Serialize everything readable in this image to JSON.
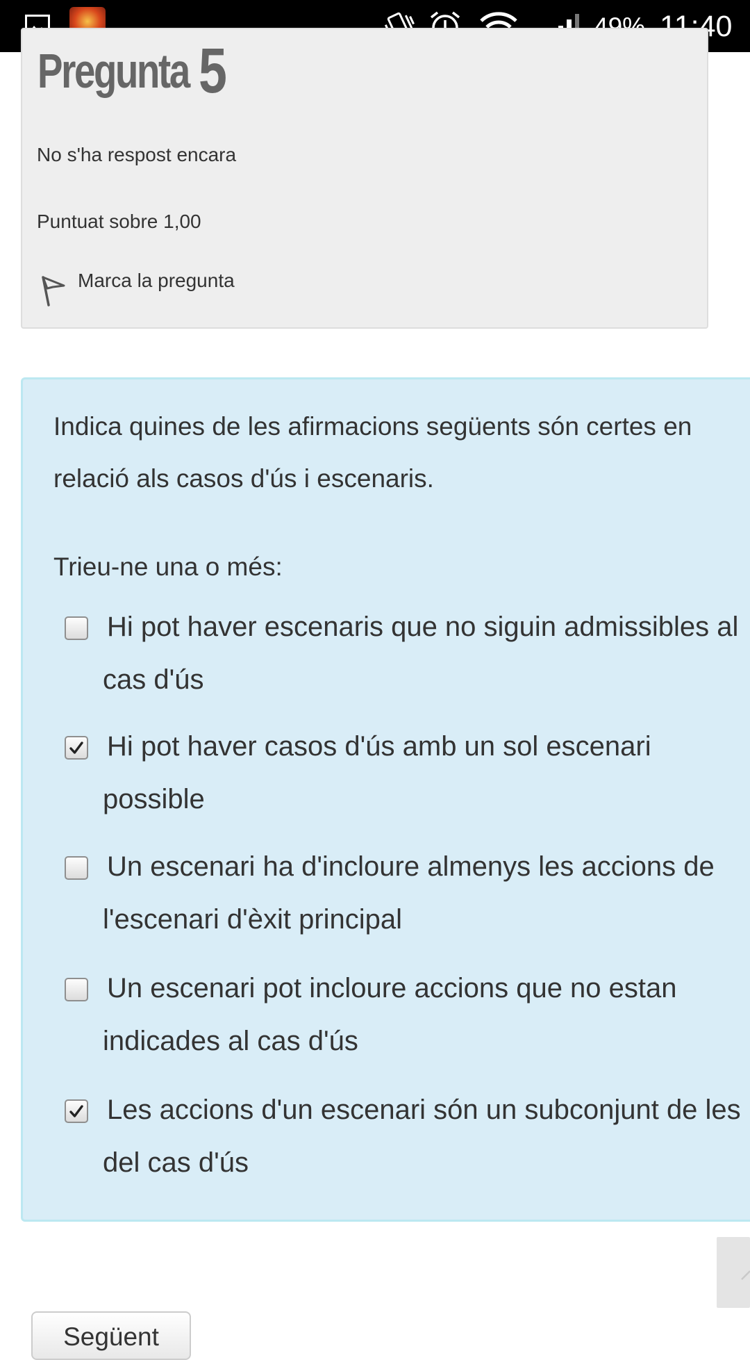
{
  "status_bar": {
    "icons": [
      "gallery-icon",
      "game-app-icon",
      "vibrate-icon",
      "alarm-icon",
      "wifi-icon",
      "signal-icon"
    ],
    "battery": "49%",
    "time": "11:40"
  },
  "question_info": {
    "label": "Pregunta",
    "number": "5",
    "state": "No s'ha respost encara",
    "grade": "Puntuat sobre 1,00",
    "flag_label": "Marca la pregunta"
  },
  "question": {
    "text": "Indica quines de les afirmacions següents són certes en relació als casos d'ús i escenaris.",
    "prompt": "Trieu-ne una o més:",
    "options": [
      {
        "label": "Hi pot haver escenaris que no siguin admissibles al cas d'ús",
        "checked": false
      },
      {
        "label": "Hi pot haver casos d'ús amb un sol escenari possible",
        "checked": true
      },
      {
        "label": "Un escenari ha d'incloure almenys les accions de l'escenari d'èxit principal",
        "checked": false
      },
      {
        "label": "Un escenari pot incloure accions que no estan indicades al cas d'ús",
        "checked": false
      },
      {
        "label": "Les accions d'un escenari són un subconjunt de les del cas d'ús",
        "checked": true
      }
    ]
  },
  "navigation": {
    "next_label": "Següent"
  },
  "colors": {
    "status_bar": "#000000",
    "info_box_bg": "#eeeeee",
    "content_box_bg": "#d9edf7",
    "content_box_border": "#bce8f1",
    "text": "#333333",
    "question_number": "#666666"
  }
}
